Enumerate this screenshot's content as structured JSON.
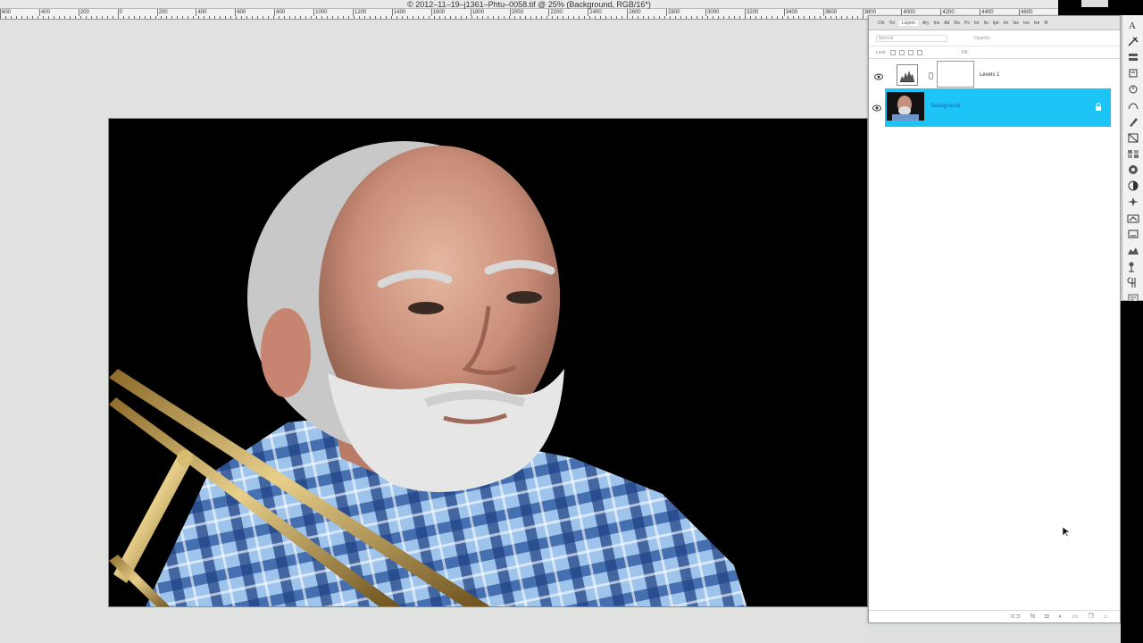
{
  "window": {
    "title": "© 2012–11–19–j1361–Phtu–0058.tif @ 25% (Background, RGB/16*)"
  },
  "ruler": {
    "labels": [
      "600",
      "400",
      "200",
      "0",
      "200",
      "400",
      "600",
      "800",
      "1000",
      "1200",
      "1400",
      "1600",
      "1800",
      "2000",
      "2200",
      "2400",
      "2600",
      "2800",
      "3000",
      "3200",
      "3400",
      "3600",
      "3800",
      "4000",
      "4200",
      "4400",
      "4600"
    ]
  },
  "layers_panel": {
    "tabs": [
      {
        "label": "Chl"
      },
      {
        "label": "Tol"
      },
      {
        "label": "Layers",
        "active": true
      },
      {
        "label": "Ary"
      },
      {
        "label": "Ins"
      },
      {
        "label": "Ad"
      },
      {
        "label": "Ihs"
      },
      {
        "label": "Ps"
      },
      {
        "label": "Ior"
      },
      {
        "label": "Iio"
      },
      {
        "label": "Ipe"
      },
      {
        "label": "Im"
      },
      {
        "label": "Ise"
      },
      {
        "label": "Ios"
      },
      {
        "label": "Ise"
      },
      {
        "label": "Ifr"
      }
    ],
    "blend_mode": "Normal",
    "opacity_label": "Opacity:",
    "lock_label": "Lock:",
    "fill_label": "Fill:",
    "layers": [
      {
        "name": "Levels 1",
        "type": "adjustment",
        "visible": true,
        "selected": false
      },
      {
        "name": "Background",
        "type": "image",
        "visible": true,
        "selected": true,
        "locked": true
      }
    ],
    "footer_icons": [
      "link-icon",
      "fx-icon",
      "mask-icon",
      "adjustment-icon",
      "group-icon",
      "new-layer-icon",
      "trash-icon"
    ]
  },
  "toolbar": {
    "tools": [
      "type-icon",
      "tools-icon",
      "layers-icon",
      "history-icon",
      "actions-icon",
      "paths-icon",
      "brush-icon",
      "transform-icon",
      "swatches-icon",
      "styles-icon",
      "channels-icon",
      "adjustments-icon",
      "navigator-icon",
      "info-icon",
      "histogram-icon",
      "clone-icon",
      "paragraph-icon",
      "notes-icon"
    ]
  },
  "colors": {
    "selected_layer": "#1cc5f5",
    "canvas_bg": "#dfe2de",
    "panel_bg": "#ffffff"
  }
}
